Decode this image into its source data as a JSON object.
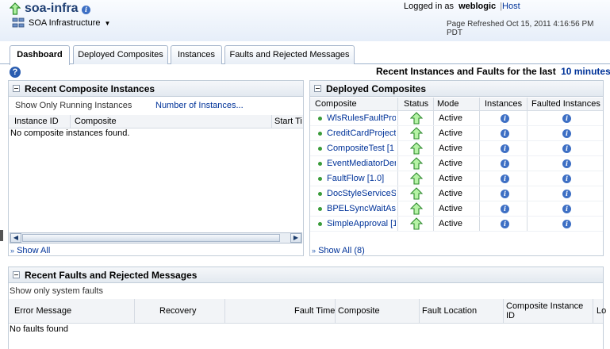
{
  "header": {
    "app_title": "soa-infra",
    "subtitle": "SOA Infrastructure",
    "logged_in_prefix": "Logged in as",
    "username": "weblogic",
    "separator": "|",
    "host_label": "Host",
    "refreshed": "Page Refreshed Oct 15, 2011 4:16:56 PM PDT"
  },
  "tabs": [
    {
      "label": "Dashboard",
      "active": true
    },
    {
      "label": "Deployed Composites",
      "active": false
    },
    {
      "label": "Instances",
      "active": false
    },
    {
      "label": "Faults and Rejected Messages",
      "active": false
    }
  ],
  "summary": {
    "text": "Recent Instances and Faults for the last",
    "period": "10 minutes"
  },
  "recent_instances": {
    "title": "Recent Composite Instances",
    "show_running_label": "Show Only Running Instances",
    "number_link": "Number of Instances...",
    "columns": [
      "Instance ID",
      "Composite",
      "Start Ti"
    ],
    "empty": "No composite instances found.",
    "show_all": "Show All"
  },
  "deployed": {
    "title": "Deployed Composites",
    "columns": [
      "Composite",
      "Status",
      "Mode",
      "Instances",
      "Faulted Instances"
    ],
    "rows": [
      {
        "name": "WlsRulesFaultProj",
        "mode": "Active"
      },
      {
        "name": "CreditCardProject",
        "mode": "Active"
      },
      {
        "name": "CompositeTest [1",
        "mode": "Active"
      },
      {
        "name": "EventMediatorDen",
        "mode": "Active"
      },
      {
        "name": "FaultFlow [1.0]",
        "mode": "Active"
      },
      {
        "name": "DocStyleServiceSe",
        "mode": "Active"
      },
      {
        "name": "BPELSyncWaitAss",
        "mode": "Active"
      },
      {
        "name": "SimpleApproval [1",
        "mode": "Active"
      }
    ],
    "show_all": "Show All (8)"
  },
  "faults": {
    "title": "Recent Faults and Rejected Messages",
    "system_only_label": "Show only system faults",
    "columns": [
      "Error Message",
      "Recovery",
      "Fault Time",
      "Composite",
      "Fault Location",
      "Composite Instance ID",
      "Lo"
    ],
    "empty": "No faults found"
  },
  "colors": {
    "link": "#003399",
    "accent_green": "#3a9b3a",
    "info_blue": "#3d6fc4",
    "border": "#c2cdd9"
  }
}
